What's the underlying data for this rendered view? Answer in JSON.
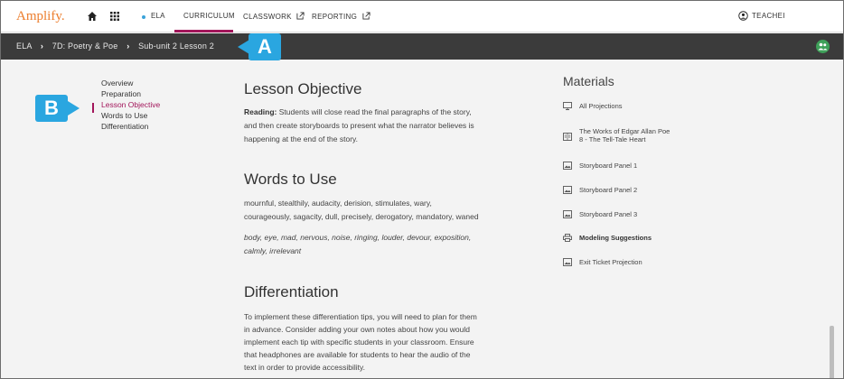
{
  "nav": {
    "logo": "Amplify.",
    "ela": "ELA",
    "curriculum": "CURRICULUM",
    "classwork": "CLASSWORK",
    "reporting": "REPORTING",
    "user": "TEACHEI"
  },
  "breadcrumb": {
    "items": [
      "ELA",
      "7D: Poetry & Poe",
      "Sub-unit 2 Lesson 2"
    ]
  },
  "callouts": {
    "a": "A",
    "b": "B"
  },
  "toc": {
    "items": [
      "Overview",
      "Preparation",
      "Lesson Objective",
      "Words to Use",
      "Differentiation"
    ],
    "active": "Lesson Objective"
  },
  "lesson_objective": {
    "heading": "Lesson Objective",
    "lead": "Reading:",
    "line1": "Students will close read the final paragraphs of the story,",
    "line2": "and then create storyboards to present what the narrator believes is",
    "line3": "happening at the end of the story."
  },
  "words_to_use": {
    "heading": "Words to Use",
    "line1": "mournful, stealthily, audacity, derision, stimulates, wary,",
    "line2": "courageously, sagacity, dull, precisely, derogatory, mandatory, waned",
    "line3": "body, eye, mad, nervous, noise, ringing, louder, devour, exposition,",
    "line4": "calmly, irrelevant"
  },
  "differentiation": {
    "heading": "Differentiation",
    "line1": "To implement these differentiation tips, you will need to plan for them",
    "line2": "in advance. Consider adding your own notes about how you would",
    "line3": "implement each tip with specific students in your classroom. Ensure",
    "line4": "that headphones are available for students to hear the audio of the",
    "line5": "text in order to provide accessibility."
  },
  "materials": {
    "title": "Materials",
    "all_projections": "All Projections",
    "works_line1": "The Works of Edgar Allan Poe",
    "works_line2": "8 - The Tell-Tale Heart",
    "panel1": "Storyboard Panel 1",
    "panel2": "Storyboard Panel 2",
    "panel3": "Storyboard Panel 3",
    "modeling": "Modeling Suggestions",
    "exit_ticket": "Exit Ticket Projection"
  },
  "colors": {
    "accent": "#a2155a",
    "brand": "#ec7d2c",
    "callout": "#2aa6e0",
    "header_bar": "#3b3b3b"
  }
}
